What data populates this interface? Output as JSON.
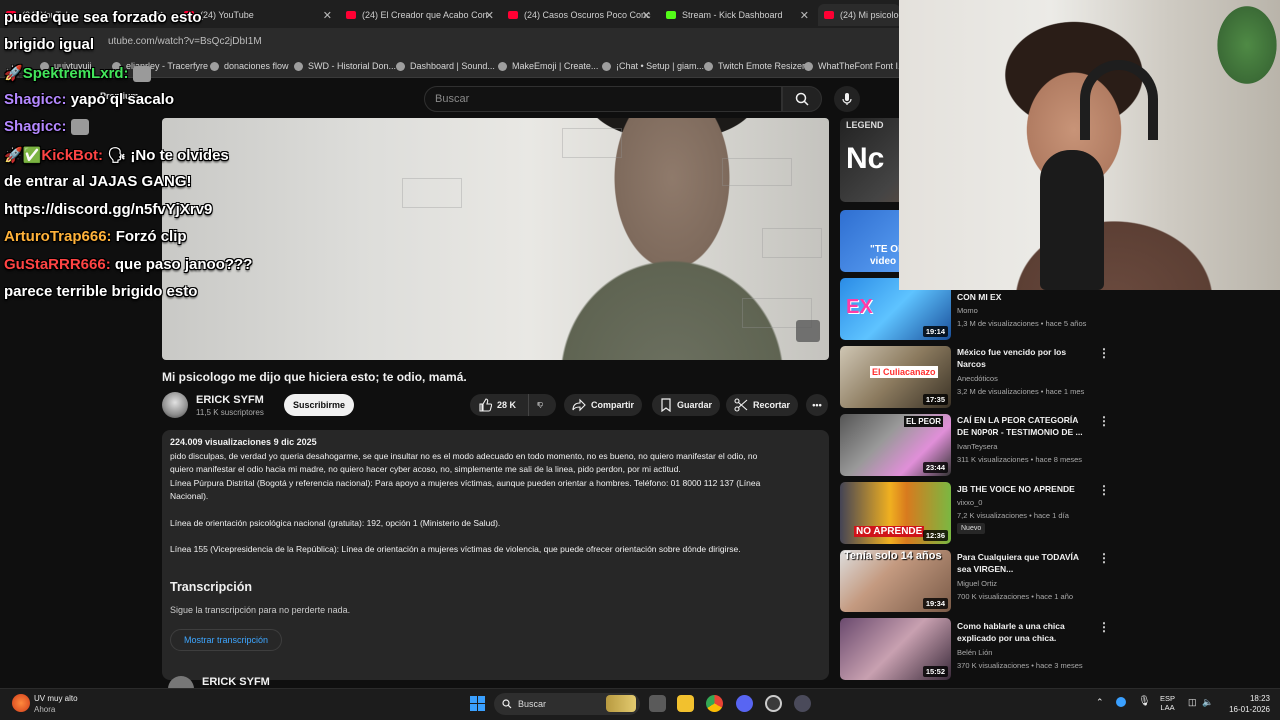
{
  "browser": {
    "tabs": [
      {
        "label": "(24) YouTube",
        "icon": "youtube-icon"
      },
      {
        "label": "(24) YouTube",
        "icon": "youtube-icon"
      },
      {
        "label": "(24) El Creador que Acabo Con",
        "icon": "youtube-icon"
      },
      {
        "label": "(24) Casos Oscuros Poco Conc",
        "icon": "youtube-icon"
      },
      {
        "label": "Stream - Kick Dashboard",
        "icon": "kick-icon"
      },
      {
        "label": "(24) Mi psicolog",
        "icon": "youtube-icon"
      }
    ],
    "url": "utube.com/watch?v=BsQc2jDbI1M",
    "bookmarks": [
      "uuiytuyuii",
      "elianrley - Tracerfyre",
      "donaciones flow",
      "SWD - Historial Don...",
      "Dashboard | Sound...",
      "MakeEmoji | Create...",
      "¡Chat • Setup | giam...",
      "Twitch Emote Resizer",
      "WhatTheFont Font I..."
    ],
    "bookmarks_extra": "Premium"
  },
  "youtube": {
    "search_placeholder": "Buscar",
    "video": {
      "title": "Mi psicologo me dijo que hiciera esto; te odio, mamá.",
      "channel": "ERICK SYFM",
      "subscribers": "11,5 K suscriptores",
      "subscribe_label": "Suscribirme",
      "likes": "28 K",
      "share_label": "Compartir",
      "save_label": "Guardar",
      "clip_label": "Recortar"
    },
    "description": {
      "meta": "224.009 visualizaciones  9 dic 2025",
      "lines": [
        "pido disculpas, de verdad yo queria desahogarme, se que insultar no es el modo adecuado en todo momento, no es bueno, no quiero manifestar el odio, no",
        "quiero manifestar el odio hacia mi madre, no quiero hacer cyber acoso, no, simplemente me sali de la linea, pido perdon, por mi actitud.",
        "Línea Púrpura Distrital (Bogotá y referencia nacional): Para apoyo a mujeres víctimas, aunque pueden orientar a hombres. Teléfono: 01 8000 112 137 (Línea",
        "Nacional).",
        "Línea de orientación psicológica nacional (gratuita): 192, opción 1 (Ministerio de Salud).",
        "Línea 155 (Vicepresidencia de la República): Línea de orientación a mujeres víctimas de violencia, que puede ofrecer orientación sobre dónde dirigirse."
      ]
    },
    "transcript": {
      "title": "Transcripción",
      "subtitle": "Sigue la transcripción para no perderte nada.",
      "button": "Mostrar transcripción"
    },
    "comment_author": "ERICK SYFM",
    "sidebar_partial_text": [
      "Nc",
      "\"TE ODIO",
      "video re"
    ],
    "recommendations": [
      {
        "title": "CON MI EX",
        "channel": "Momo",
        "stats": "1,3 M de visualizaciones • hace 5 años",
        "duration": "19:14",
        "thumb_text": "EX"
      },
      {
        "title": "México fue vencido por los Narcos",
        "channel": "Anecdóticos",
        "stats": "3,2 M de visualizaciones • hace 1 mes",
        "duration": "17:35",
        "thumb_text": "El Culiacanazo"
      },
      {
        "title": "CAÍ EN LA PEOR CATEGORÍA DE N0P0R - TESTIMONIO DE ...",
        "channel": "IvanTeysera",
        "stats": "311 K visualizaciones • hace 8 meses",
        "duration": "23:44",
        "thumb_text": "EL PEOR"
      },
      {
        "title": "JB THE VOICE NO APRENDE",
        "channel": "vixxo_0",
        "stats": "7,2 K visualizaciones • hace 1 día",
        "duration": "12:36",
        "thumb_text": "NO APRENDE",
        "badge": "Nuevo"
      },
      {
        "title": "Para Cualquiera que TODAVÍA sea VIRGEN...",
        "channel": "Miguel Ortiz",
        "stats": "700 K visualizaciones • hace 1 año",
        "duration": "19:34",
        "thumb_text": "Tenía solo 14 años"
      },
      {
        "title": "Como hablarle a una chica explicado por una chica.",
        "channel": "Belén Lión",
        "stats": "370 K visualizaciones • hace 3 meses",
        "duration": "15:52",
        "thumb_text": ""
      }
    ]
  },
  "chat": [
    {
      "user": "",
      "text": "puede que sea forzado esto"
    },
    {
      "user": "",
      "text": "brigido igual"
    },
    {
      "user": "SpektremLxrd:",
      "text": ""
    },
    {
      "user": "Shagicc:",
      "text": " yapo ql sacalo"
    },
    {
      "user": "Shagicc:",
      "text": ""
    },
    {
      "user": "KickBot:",
      "text": " ¡No te olvides"
    },
    {
      "user": "",
      "text": "de entrar al JAJAS GANG!"
    },
    {
      "user": "",
      "text": "https://discord.gg/n5fvYjXrv9"
    },
    {
      "user": "ArturoTrap666:",
      "text": " Forzó clip"
    },
    {
      "user": "GuStaRRR666:",
      "text": " que paso janoo???"
    },
    {
      "user": "",
      "text": "parece terrible brigido esto"
    }
  ],
  "taskbar": {
    "weather": "UV muy alto",
    "weather_sub": "Ahora",
    "search": "Buscar",
    "lang": "ESP",
    "lang_sub": "LAA",
    "time": "18:23",
    "date": "16-01-2026"
  },
  "colors": {
    "youtube_red": "#ff0033",
    "kick_green": "#53fc18",
    "link_blue": "#3ea6ff",
    "chat_yellow": "#ffd700",
    "chat_violet": "#b488ff",
    "chat_red": "#ff4444",
    "chat_orange": "#ffb23a"
  }
}
